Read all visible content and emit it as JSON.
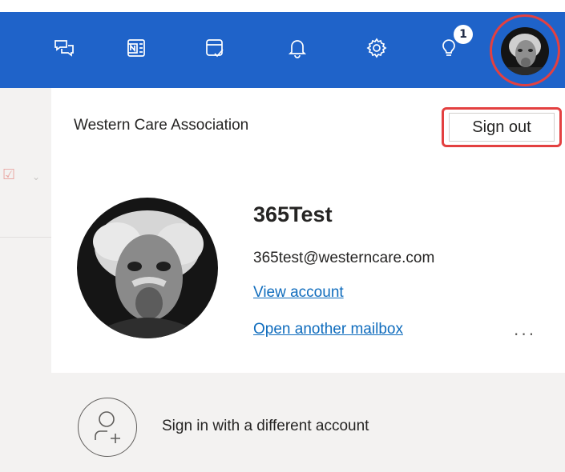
{
  "topbar": {
    "icons": [
      "feedback-icon",
      "onenote-icon",
      "my-day-icon",
      "notifications-icon",
      "settings-icon",
      "tips-icon"
    ],
    "tips_badge": "1",
    "accent_color": "#1f63c9"
  },
  "account_panel": {
    "org_name": "Western Care Association",
    "sign_out_label": "Sign out",
    "display_name": "365Test",
    "email": "365test@westerncare.com",
    "view_account_label": "View account",
    "open_mailbox_label": "Open another mailbox",
    "more_label": "...",
    "sign_in_different_label": "Sign in with a different account"
  }
}
